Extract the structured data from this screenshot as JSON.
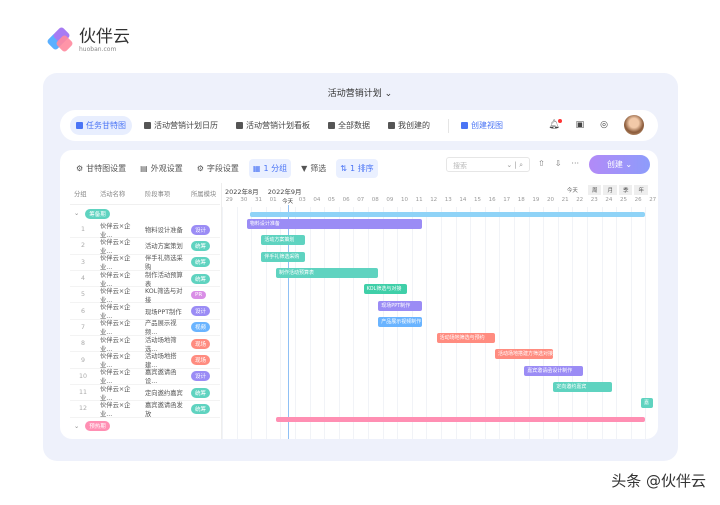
{
  "logo": {
    "name": "伙伴云",
    "domain": "huoban.com"
  },
  "title": "活动营销计划",
  "nav": {
    "tabs": [
      {
        "label": "任务甘特图",
        "active": true
      },
      {
        "label": "活动营销计划日历"
      },
      {
        "label": "活动营销计划看板"
      },
      {
        "label": "全部数据"
      },
      {
        "label": "我创建的"
      }
    ],
    "create_view": "创建视图"
  },
  "toolbar": {
    "gantt_settings": "甘特图设置",
    "appearance": "外观设置",
    "fields": "字段设置",
    "group": "1 分组",
    "filter": "筛选",
    "sort": "1 排序",
    "search_placeholder": "搜索",
    "create": "创建"
  },
  "table": {
    "headers": [
      "分组",
      "活动名称",
      "阶段事项",
      "所属模块"
    ],
    "groups": [
      {
        "label": "筹备期",
        "color": "#5fd3c0",
        "bar_color": "#8fd3f7",
        "start": 1.9,
        "end": 29
      }
    ],
    "group2": {
      "label": "预热期",
      "color": "#ff8fb3",
      "start": 3.7,
      "end": 29
    },
    "rows": [
      {
        "n": "1",
        "name": "伙伴云×企业...",
        "task": "物料设计准备",
        "module": "设计",
        "mcolor": "#9b8cf5",
        "start": 1.7,
        "end": 13.7
      },
      {
        "n": "2",
        "name": "伙伴云×企业...",
        "task": "活动方案策划",
        "module": "统筹",
        "mcolor": "#5fd3c0",
        "start": 2.7,
        "end": 5.7
      },
      {
        "n": "3",
        "name": "伙伴云×企业...",
        "task": "伴手礼筛选采购",
        "module": "统筹",
        "mcolor": "#5fd3c0",
        "start": 2.7,
        "end": 5.7
      },
      {
        "n": "4",
        "name": "伙伴云×企业...",
        "task": "制作活动预算表",
        "module": "统筹",
        "mcolor": "#5fd3c0",
        "start": 3.7,
        "end": 10.7
      },
      {
        "n": "5",
        "name": "伙伴云×企业...",
        "task": "KOL筛选与对接",
        "module": "PR",
        "mcolor": "#d98ee6",
        "start": 9.7,
        "end": 12.7,
        "bcolor": "#3fcfa8"
      },
      {
        "n": "6",
        "name": "伙伴云×企业...",
        "task": "现场PPT制作",
        "module": "设计",
        "mcolor": "#9b8cf5",
        "start": 10.7,
        "end": 13.7
      },
      {
        "n": "7",
        "name": "伙伴云×企业...",
        "task": "产品展示视频...",
        "bar": "产品展示视频制作",
        "module": "视频",
        "mcolor": "#6ab4ff",
        "start": 10.7,
        "end": 13.7
      },
      {
        "n": "8",
        "name": "伙伴云×企业...",
        "task": "活动场地筛选...",
        "bar": "活动场地筛选与预约",
        "module": "现场",
        "mcolor": "#ff8c80",
        "start": 14.7,
        "end": 18.7
      },
      {
        "n": "9",
        "name": "伙伴云×企业...",
        "task": "活动场地搭建...",
        "bar": "活动场地搭建方筛选对接",
        "module": "现场",
        "mcolor": "#ff8c80",
        "start": 18.7,
        "end": 22.7
      },
      {
        "n": "10",
        "name": "伙伴云×企业...",
        "task": "嘉宾邀请函设...",
        "bar": "嘉宾邀请函设计制作",
        "module": "设计",
        "mcolor": "#9b8cf5",
        "start": 20.7,
        "end": 24.7
      },
      {
        "n": "11",
        "name": "伙伴云×企业...",
        "task": "定向邀约嘉宾",
        "module": "统筹",
        "mcolor": "#5fd3c0",
        "start": 22.7,
        "end": 26.7
      },
      {
        "n": "12",
        "name": "伙伴云×企业...",
        "task": "嘉宾邀请函发放",
        "bar": "嘉",
        "module": "统筹",
        "mcolor": "#5fd3c0",
        "start": 28.7,
        "end": 29.5
      }
    ]
  },
  "timeline": {
    "months": [
      "2022年8月",
      "2022年9月"
    ],
    "days": [
      "29",
      "30",
      "31",
      "01",
      "今天",
      "03",
      "04",
      "05",
      "06",
      "07",
      "08",
      "09",
      "10",
      "11",
      "12",
      "13",
      "14",
      "15",
      "16",
      "17",
      "18",
      "19",
      "20",
      "21",
      "22",
      "23",
      "24",
      "25",
      "26",
      "27"
    ],
    "today_label": "今天",
    "scales": [
      "周",
      "月",
      "季",
      "年"
    ]
  },
  "watermark": "头条 @伙伴云"
}
